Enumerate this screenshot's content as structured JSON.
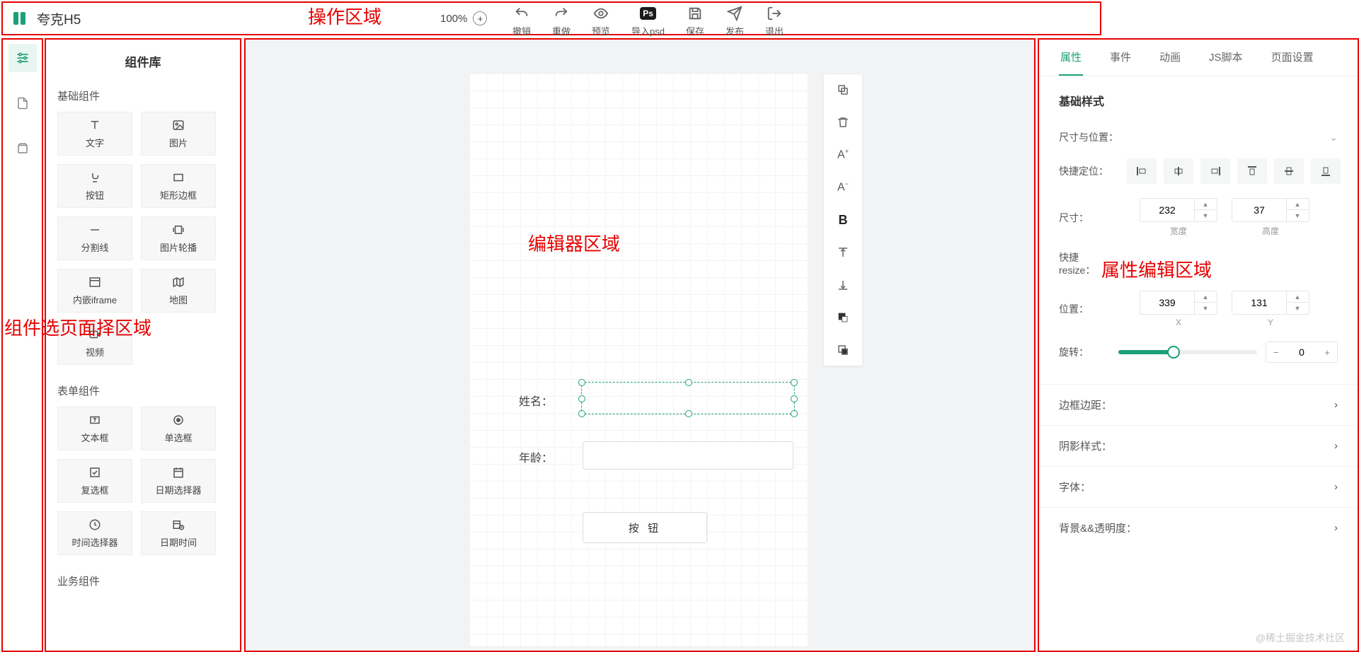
{
  "app": {
    "title": "夸克H5"
  },
  "annotations": {
    "toolbar": "操作区域",
    "component_panel": "组件选页面择区域",
    "editor": "编辑器区域",
    "property_panel": "属性编辑区域"
  },
  "toolbar": {
    "zoom": "100%",
    "items": [
      {
        "icon": "undo-icon",
        "label": "撤销"
      },
      {
        "icon": "redo-icon",
        "label": "重做"
      },
      {
        "icon": "preview-icon",
        "label": "预览"
      },
      {
        "icon": "psd-icon",
        "label": "导入psd"
      },
      {
        "icon": "save-icon",
        "label": "保存"
      },
      {
        "icon": "publish-icon",
        "label": "发布"
      },
      {
        "icon": "exit-icon",
        "label": "退出"
      }
    ]
  },
  "left_rail": {
    "items": [
      {
        "icon": "components-icon",
        "active": true
      },
      {
        "icon": "page-icon",
        "active": false
      },
      {
        "icon": "layers-icon",
        "active": false
      }
    ]
  },
  "components": {
    "title": "组件库",
    "basic_label": "基础组件",
    "basic": [
      {
        "icon": "text-icon",
        "label": "文字"
      },
      {
        "icon": "image-icon",
        "label": "图片"
      },
      {
        "icon": "button-icon",
        "label": "按钮"
      },
      {
        "icon": "rect-icon",
        "label": "矩形边框"
      },
      {
        "icon": "divider-icon",
        "label": "分割线"
      },
      {
        "icon": "carousel-icon",
        "label": "图片轮播"
      },
      {
        "icon": "iframe-icon",
        "label": "内嵌iframe"
      },
      {
        "icon": "map-icon",
        "label": "地图"
      },
      {
        "icon": "video-icon",
        "label": "视频"
      }
    ],
    "form_label": "表单组件",
    "form": [
      {
        "icon": "textbox-icon",
        "label": "文本框"
      },
      {
        "icon": "radio-icon",
        "label": "单选框"
      },
      {
        "icon": "checkbox-icon",
        "label": "复选框"
      },
      {
        "icon": "date-icon",
        "label": "日期选择器"
      },
      {
        "icon": "time-icon",
        "label": "时间选择器"
      },
      {
        "icon": "datetime-icon",
        "label": "日期时间"
      }
    ],
    "business_label": "业务组件"
  },
  "canvas": {
    "name_label": "姓名：",
    "age_label": "年龄：",
    "button_label": "按 钮"
  },
  "float_toolbar": [
    "copy-icon",
    "delete-icon",
    "font-increase-icon",
    "font-decrease-icon",
    "bold-icon",
    "align-top-icon",
    "align-bottom-icon",
    "bring-front-icon",
    "send-back-icon"
  ],
  "properties": {
    "tabs": [
      "属性",
      "事件",
      "动画",
      "JS脚本",
      "页面设置"
    ],
    "section_title": "基础样式",
    "size_pos_label": "尺寸与位置：",
    "quick_anchor_label": "快捷定位：",
    "size_label": "尺寸：",
    "width": "232",
    "height": "37",
    "width_foot": "宽度",
    "height_foot": "高度",
    "resize_label_1": "快捷",
    "resize_label_2": "resize：",
    "pos_label": "位置：",
    "x": "339",
    "y": "131",
    "x_foot": "X",
    "y_foot": "Y",
    "rotate_label": "旋转：",
    "rotate_value": "0",
    "accordion": [
      "边框边距：",
      "阴影样式：",
      "字体：",
      "背景&&透明度："
    ]
  },
  "watermark": "@稀土掘金技术社区"
}
